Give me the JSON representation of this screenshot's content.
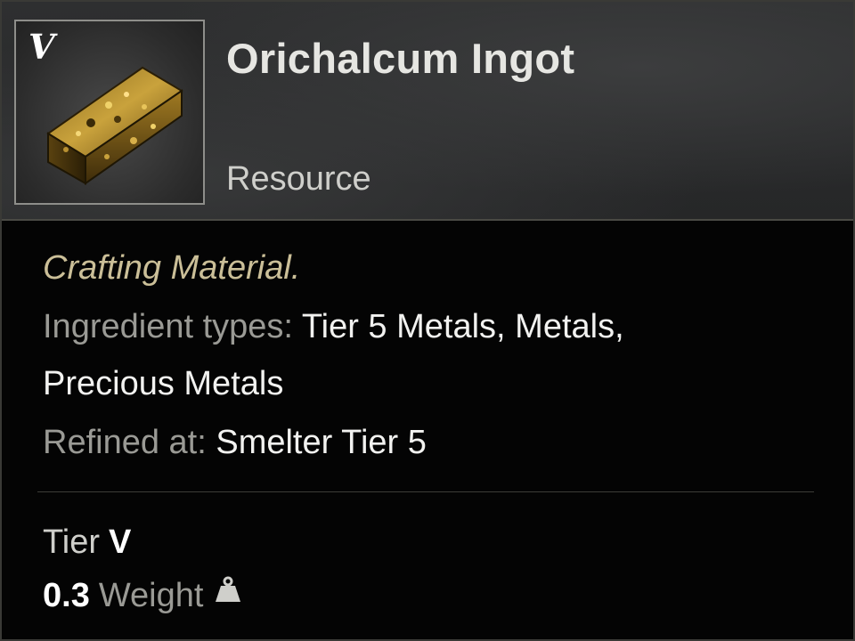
{
  "item": {
    "tier_badge": "V",
    "name": "Orichalcum Ingot",
    "type": "Resource",
    "icon": "gold-ingot-icon",
    "flavor": "Crafting Material.",
    "ingredient_label": "Ingredient types:",
    "ingredient_values_line1": "Tier 5 Metals, Metals,",
    "ingredient_values_line2": "Precious Metals",
    "refined_label": "Refined at:",
    "refined_value": "Smelter Tier 5",
    "tier_label": "Tier",
    "tier_value": "V",
    "weight_value": "0.3",
    "weight_label": "Weight",
    "weight_icon": "weight-icon"
  },
  "colors": {
    "flavor_text": "#cbbf98",
    "label_text": "#9a9a95",
    "value_text": "#f2f2f0",
    "header_bg": "#2e2f30",
    "body_bg": "#040404"
  }
}
